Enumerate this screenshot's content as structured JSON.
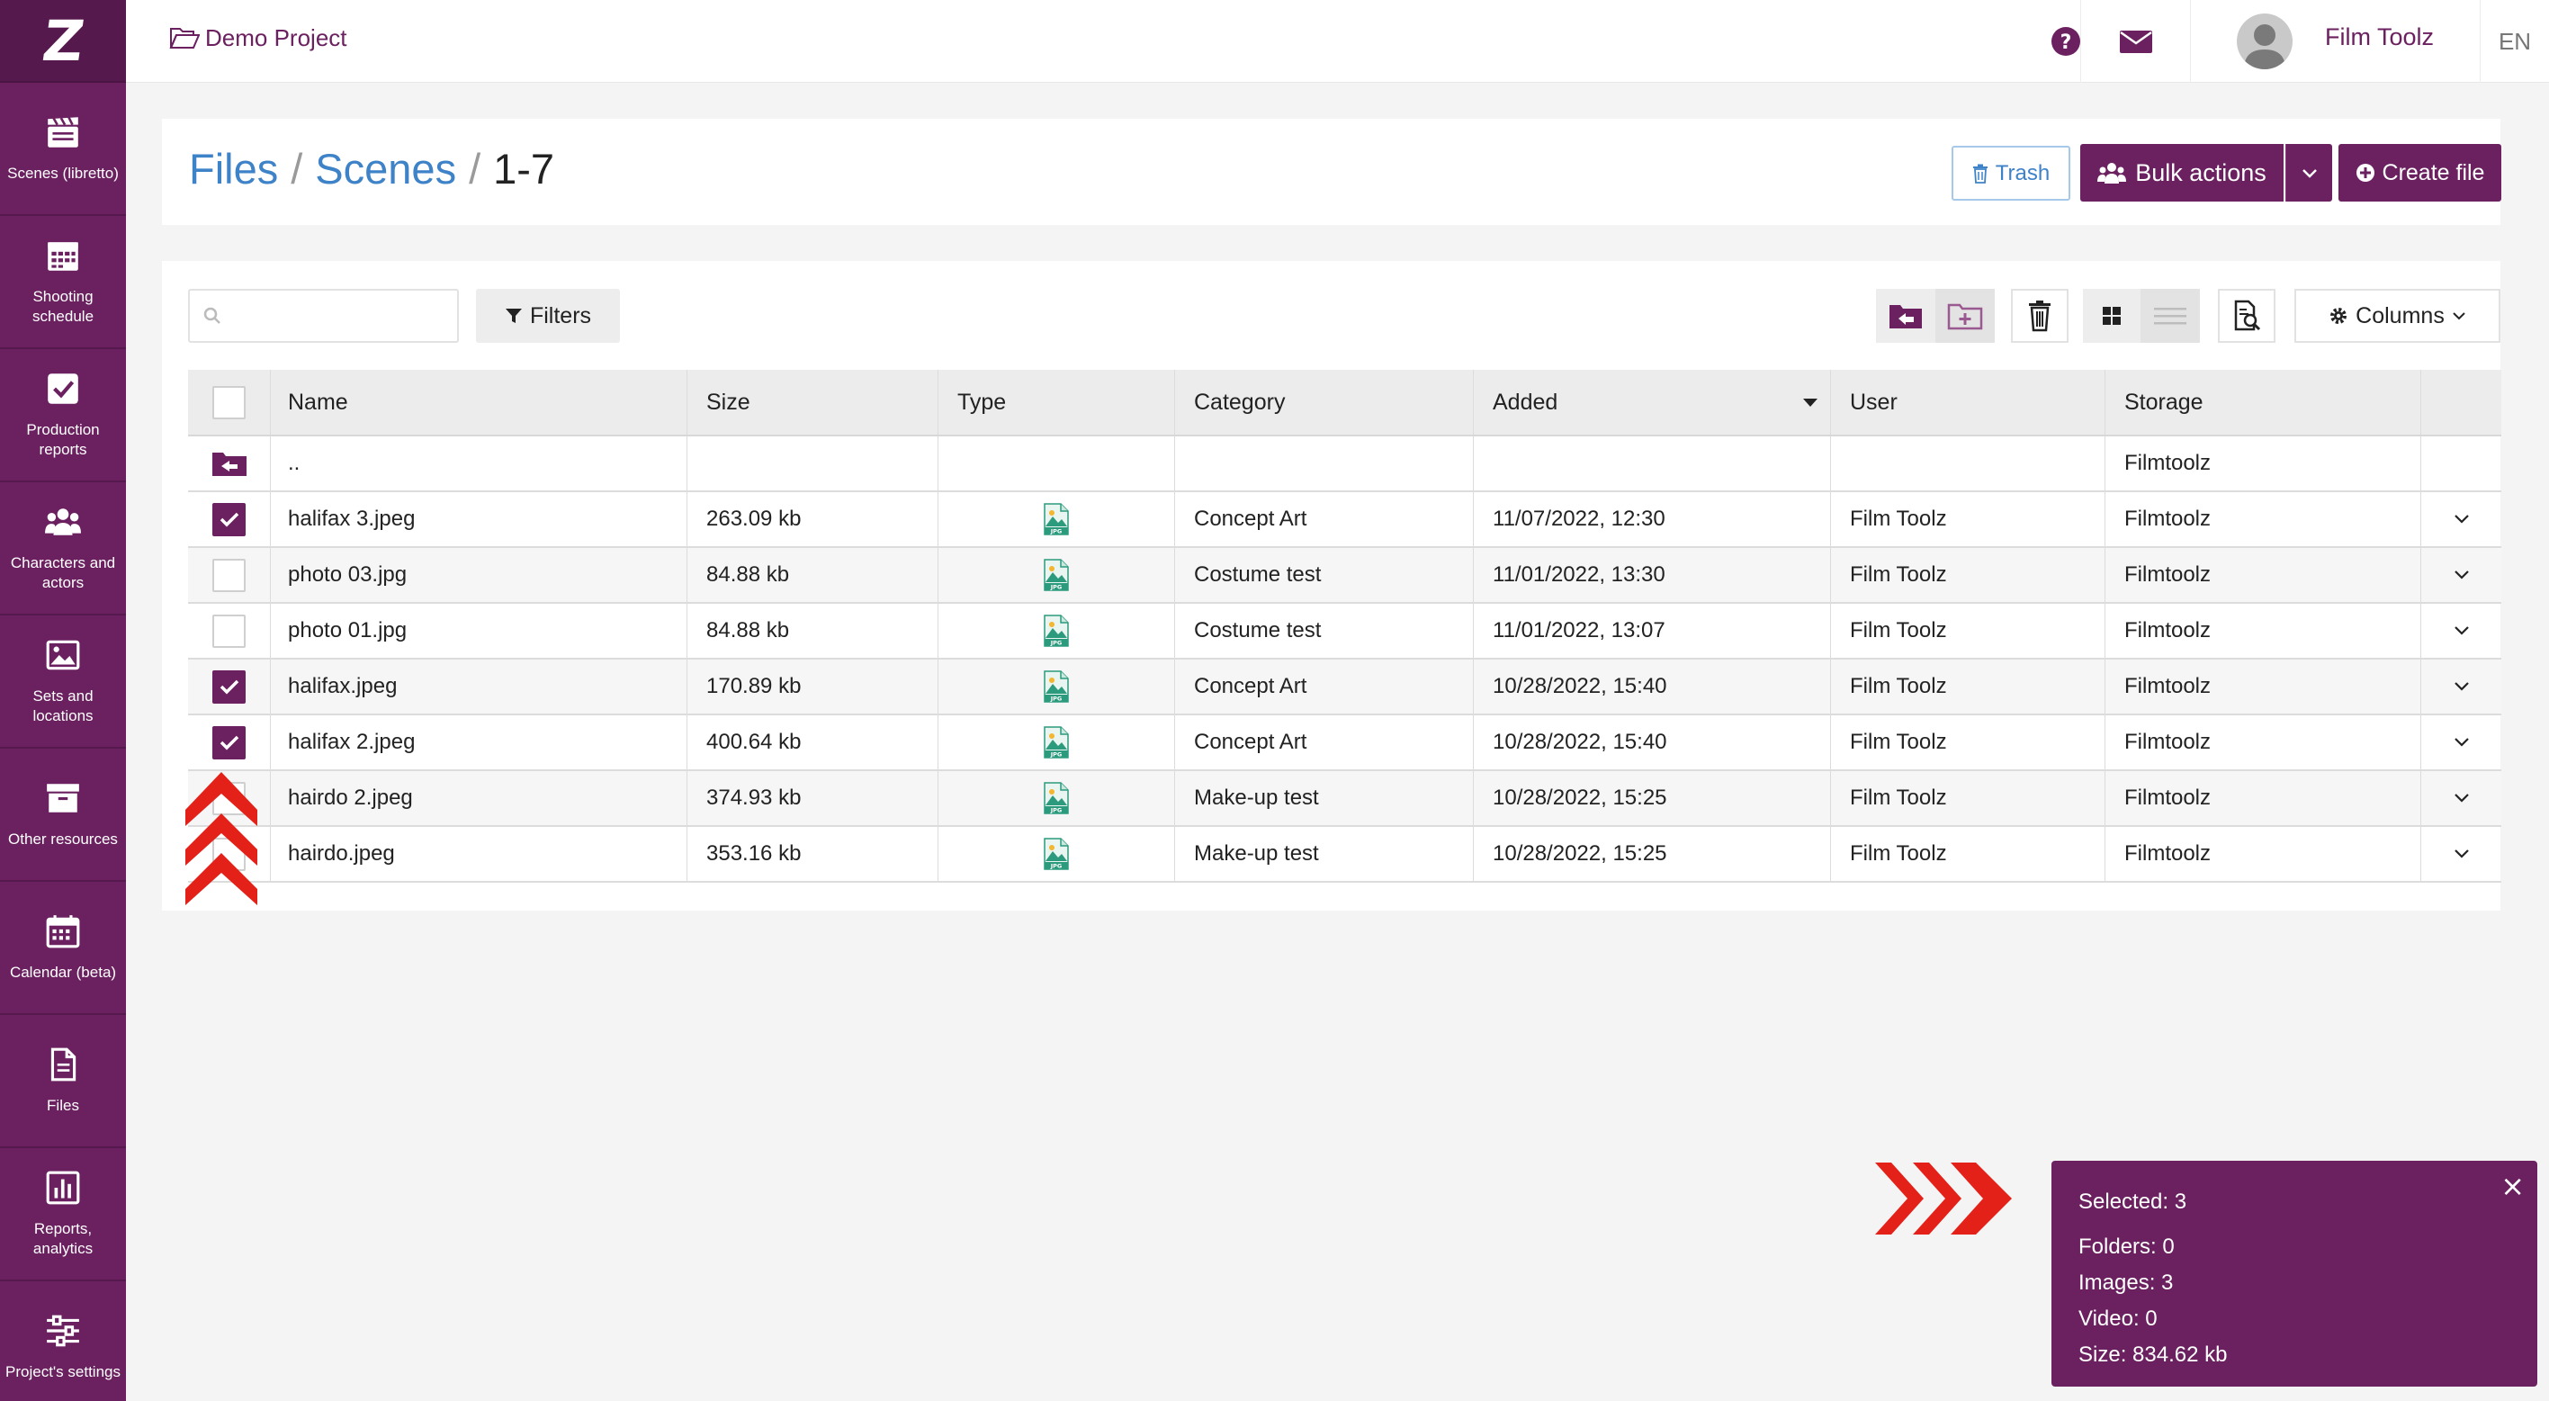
{
  "project": {
    "name": "Demo Project"
  },
  "user": {
    "name": "Film Toolz"
  },
  "lang": "EN",
  "sidebar": {
    "items": [
      {
        "label": "Scenes (libretto)",
        "icon": "clapperboard-icon"
      },
      {
        "label": "Shooting schedule",
        "icon": "calendar-grid-icon"
      },
      {
        "label": "Production reports",
        "icon": "checkbox-icon"
      },
      {
        "label": "Characters and actors",
        "icon": "users-icon"
      },
      {
        "label": "Sets and locations",
        "icon": "picture-icon"
      },
      {
        "label": "Other resources",
        "icon": "archive-box-icon"
      },
      {
        "label": "Calendar (beta)",
        "icon": "calendar-icon"
      },
      {
        "label": "Files",
        "icon": "file-icon"
      },
      {
        "label": "Reports, analytics",
        "icon": "bar-chart-icon"
      },
      {
        "label": "Project's settings",
        "icon": "sliders-icon"
      }
    ]
  },
  "breadcrumb": {
    "root": "Files",
    "parent": "Scenes",
    "sep": "/",
    "current": "1-7"
  },
  "actions": {
    "trash": "Trash",
    "bulk": "Bulk actions",
    "create": "Create file"
  },
  "toolbar": {
    "search_placeholder": "",
    "filters": "Filters",
    "columns": "Columns"
  },
  "table": {
    "headers": [
      "Name",
      "Size",
      "Type",
      "Category",
      "Added",
      "User",
      "Storage"
    ],
    "parent_row": {
      "name": "..",
      "storage": "Filmtoolz"
    },
    "rows": [
      {
        "checked": true,
        "name": "halifax 3.jpeg",
        "size": "263.09 kb",
        "type": "jpg",
        "category": "Concept Art",
        "added": "11/07/2022, 12:30",
        "user": "Film Toolz",
        "storage": "Filmtoolz"
      },
      {
        "checked": false,
        "name": "photo 03.jpg",
        "size": "84.88 kb",
        "type": "jpg",
        "category": "Costume test",
        "added": "11/01/2022, 13:30",
        "user": "Film Toolz",
        "storage": "Filmtoolz"
      },
      {
        "checked": false,
        "name": "photo 01.jpg",
        "size": "84.88 kb",
        "type": "jpg",
        "category": "Costume test",
        "added": "11/01/2022, 13:07",
        "user": "Film Toolz",
        "storage": "Filmtoolz"
      },
      {
        "checked": true,
        "name": "halifax.jpeg",
        "size": "170.89 kb",
        "type": "jpg",
        "category": "Concept Art",
        "added": "10/28/2022, 15:40",
        "user": "Film Toolz",
        "storage": "Filmtoolz"
      },
      {
        "checked": true,
        "name": "halifax 2.jpeg",
        "size": "400.64 kb",
        "type": "jpg",
        "category": "Concept Art",
        "added": "10/28/2022, 15:40",
        "user": "Film Toolz",
        "storage": "Filmtoolz"
      },
      {
        "checked": false,
        "name": "hairdo 2.jpeg",
        "size": "374.93 kb",
        "type": "jpg",
        "category": "Make-up test",
        "added": "10/28/2022, 15:25",
        "user": "Film Toolz",
        "storage": "Filmtoolz"
      },
      {
        "checked": false,
        "name": "hairdo.jpeg",
        "size": "353.16 kb",
        "type": "jpg",
        "category": "Make-up test",
        "added": "10/28/2022, 15:25",
        "user": "Film Toolz",
        "storage": "Filmtoolz"
      }
    ]
  },
  "selection": {
    "selected": "Selected: 3",
    "folders": "Folders: 0",
    "images": "Images: 3",
    "video": "Video: 0",
    "size": "Size: 834.62 kb",
    "close": "×"
  },
  "colors": {
    "brand": "#6b2160",
    "link": "#3e82c8",
    "annotation": "#e32119"
  }
}
